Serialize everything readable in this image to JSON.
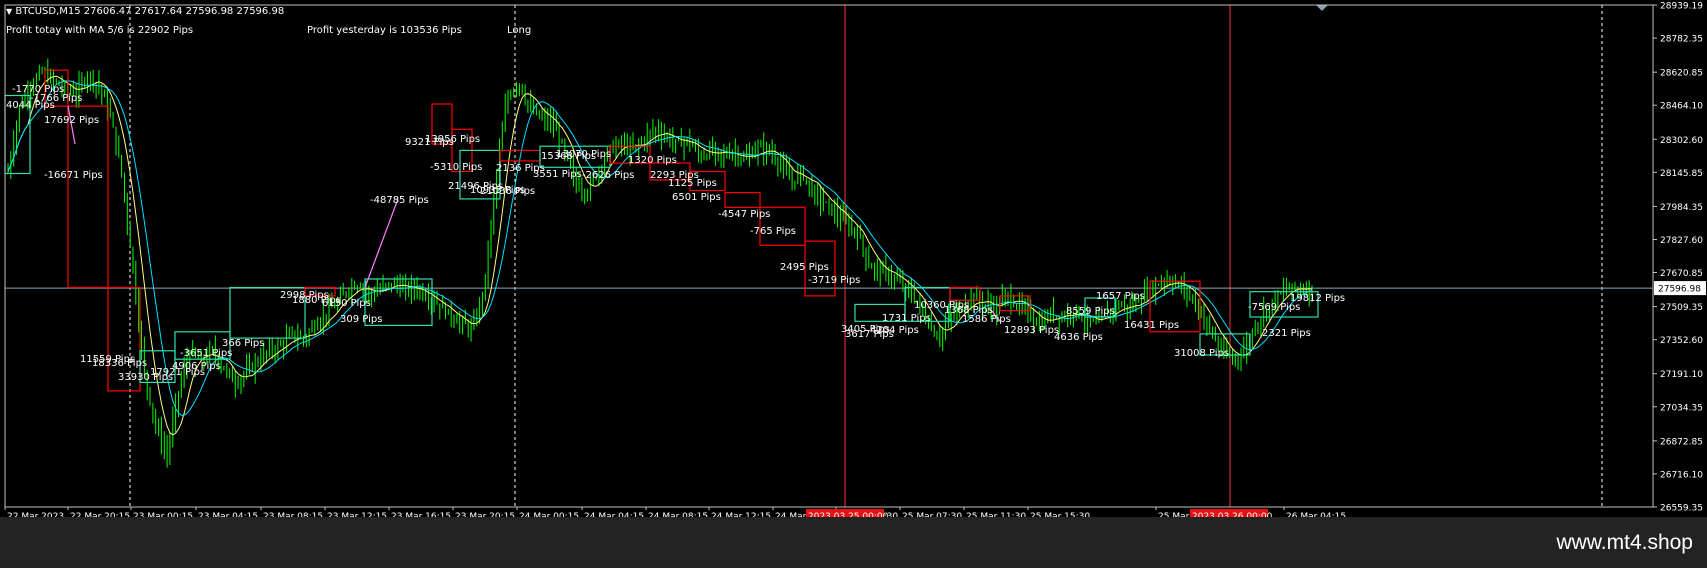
{
  "header": {
    "symbol_line": "BTCUSD,M15  27606.47 27617.64 27596.98 27596.98",
    "profit_today": "Profit totay with MA 5/6 is 22902 Pips",
    "profit_yesterday": "Profit yesterday is 103536 Pips",
    "direction": "Long"
  },
  "colors": {
    "background": "#000000",
    "candles": "#00ff00",
    "ma_fast": "#ffff80",
    "ma_slow": "#00e0ff",
    "loss_box": "#ff0000",
    "win_box": "#30e0b0",
    "transition": "#ff80ff",
    "session_line": "#ff3030",
    "day_sep": "#ffffff",
    "price_line": "#8fa8b8",
    "date_highlight": "#e81010"
  },
  "brand": "www.mt4.shop",
  "chart_data": {
    "type": "candlestick",
    "title": "BTCUSD,M15",
    "ylim": [
      26559.35,
      28939.19
    ],
    "yticks": [
      "28939.19",
      "28782.35",
      "28620.85",
      "28464.10",
      "28302.60",
      "28145.85",
      "27984.35",
      "27827.60",
      "27670.85",
      "27509.35",
      "27352.60",
      "27191.10",
      "27034.35",
      "26872.85",
      "26716.10",
      "26559.35"
    ],
    "current_price": "27596.98",
    "xticks": [
      "22 Mar 2023",
      "22 Mar 20:15",
      "23 Mar 00:15",
      "23 Mar 04:15",
      "23 Mar 08:15",
      "23 Mar 12:15",
      "23 Mar 16:15",
      "23 Mar 20:15",
      "24 Mar 00:15",
      "24 Mar 04:15",
      "24 Mar 08:15",
      "24 Mar 12:15",
      "24 Mar",
      "25 Mar 03:30",
      "25 Mar 07:30",
      "25 Mar 11:30",
      "25 Mar 15:30",
      "25 Mar",
      "26 Mar 04:15"
    ],
    "highlighted_dates": [
      "2023.03.25 00:00",
      "2023.03.26 00:00"
    ],
    "price_path": [
      28150,
      28450,
      28560,
      28620,
      28580,
      28540,
      28520,
      28610,
      28560,
      28420,
      28150,
      27700,
      27200,
      26950,
      26800,
      27100,
      27300,
      27250,
      27300,
      27220,
      27150,
      27200,
      27250,
      27300,
      27320,
      27380,
      27350,
      27420,
      27480,
      27520,
      27600,
      27620,
      27560,
      27600,
      27620,
      27590,
      27600,
      27560,
      27520,
      27470,
      27430,
      27400,
      27600,
      28100,
      28500,
      28580,
      28450,
      28400,
      28380,
      28250,
      28100,
      28050,
      28150,
      28250,
      28280,
      28250,
      28300,
      28350,
      28320,
      28280,
      28300,
      28220,
      28250,
      28220,
      28250,
      28200,
      28260,
      28250,
      28200,
      28100,
      28150,
      28050,
      28000,
      27950,
      27900,
      27850,
      27700,
      27680,
      27650,
      27600,
      27550,
      27450,
      27360,
      27450,
      27500,
      27560,
      27520,
      27500,
      27560,
      27520,
      27480,
      27420,
      27480,
      27460,
      27500,
      27450,
      27420,
      27480,
      27520,
      27500,
      27560,
      27600,
      27640,
      27620,
      27580,
      27500,
      27400,
      27300,
      27260,
      27300,
      27420,
      27500,
      27560,
      27600,
      27590,
      27600
    ],
    "trade_labels": [
      "-1770 Pips",
      "4044 Pips",
      "-1766 Pips",
      "17692 Pips",
      "-16671 Pips",
      "11559 Pips",
      "18336 Pips",
      "33930 Pips",
      "17921 Pips",
      "4906 Pips",
      "-3651 Pips",
      "366 Pips",
      "2998 Pips",
      "1880 Pips",
      "6150 Pips",
      "309 Pips",
      "-48785 Pips",
      "9321 Pips",
      "13956 Pips",
      "-5310 Pips",
      "21496 Pips",
      "10933 Pips",
      "21036 Pips",
      "2136 Pips",
      "15368 Pips",
      "3551 Pips",
      "13070 Pips",
      "-2626 Pips",
      "1320 Pips",
      "2293 Pips",
      "1125 Pips",
      "6501 Pips",
      "-4547 Pips",
      "-765 Pips",
      "2495 Pips",
      "-3719 Pips",
      "3405 Pips",
      "3617 Pips",
      "4204 Pips",
      "1731 Pips",
      "10360 Pips",
      "1368 Pips",
      "1586 Pips",
      "12893 Pips",
      "8559 Pips",
      "4636 Pips",
      "1657 Pips",
      "16431 Pips",
      "31008 Pips",
      "-7569 Pips",
      "2321 Pips",
      "19812 Pips"
    ]
  }
}
